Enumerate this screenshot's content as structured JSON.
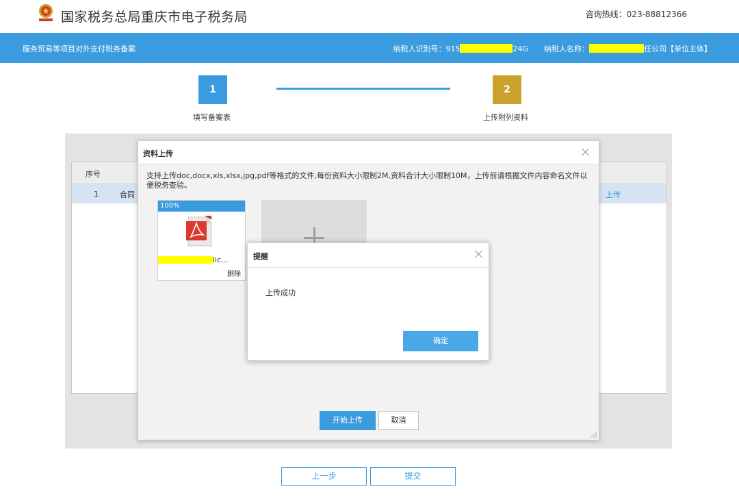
{
  "header": {
    "site_title": "国家税务总局重庆市电子税务局",
    "hotline": "咨询热线：023-88812366",
    "emblem_icon": "tax-emblem-icon"
  },
  "nav": {
    "page_title": "服务贸易等项目对外支付税务备案",
    "taxpayer_id_label": "纳税人识别号：",
    "taxpayer_id_prefix": "915",
    "taxpayer_id_suffix": "24G",
    "taxpayer_name_label": "纳税人名称：",
    "taxpayer_name_suffix": "任公司【单位主体】"
  },
  "steps": [
    {
      "number": "1",
      "label": "填写备案表"
    },
    {
      "number": "2",
      "label": "上传附列资料"
    }
  ],
  "background_table": {
    "header_seq": "序号",
    "row": {
      "seq": "1",
      "name": "合同",
      "action": "上传"
    }
  },
  "footer": {
    "prev_label": "上一步",
    "submit_label": "提交"
  },
  "upload_dialog": {
    "title": "资料上传",
    "hint": "支持上传doc,docx,xls,xlsx,jpg,pdf等格式的文件,每份资料大小限制2M,资料合计大小限制10M，上传前请根据文件内容命名文件以便税务查验。",
    "file": {
      "progress_text": "100%",
      "progress": 1.0,
      "name_suffix": "lic...",
      "delete_label": "删除",
      "icon": "pdf-file-icon"
    },
    "add_icon": "plus-icon",
    "start_label": "开始上传",
    "cancel_label": "取消"
  },
  "alert_dialog": {
    "title": "提醒",
    "message": "上传成功",
    "ok_label": "确定"
  },
  "colors": {
    "primary_blue": "#3a9bde",
    "step2_gold": "#c9a12b",
    "redaction_yellow": "#ffff00"
  }
}
